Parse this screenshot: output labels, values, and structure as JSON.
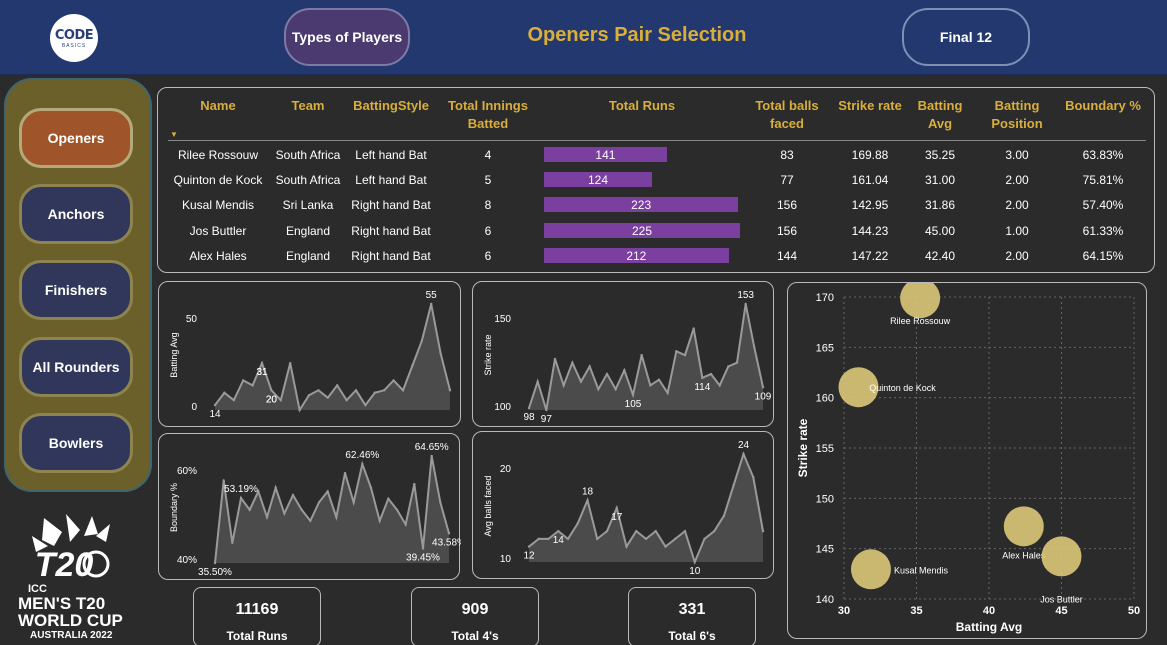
{
  "header": {
    "logo_line1": "CODE",
    "logo_line2": "BASICS",
    "types_button": "Types of Players",
    "title": "Openers Pair Selection",
    "final_button": "Final 12"
  },
  "sidebar": {
    "items": [
      {
        "label": "Openers",
        "active": true
      },
      {
        "label": "Anchors",
        "active": false
      },
      {
        "label": "Finishers",
        "active": false
      },
      {
        "label": "All Rounders",
        "active": false
      },
      {
        "label": "Bowlers",
        "active": false
      }
    ]
  },
  "branding": {
    "line1": "ICC",
    "line2": "MEN'S T20",
    "line3": "WORLD CUP",
    "line4": "AUSTRALIA 2022"
  },
  "table": {
    "headers": [
      "Name",
      "Team",
      "BattingStyle",
      "Total Innings Batted",
      "Total Runs",
      "Total balls faced",
      "Strike rate",
      "Batting Avg",
      "Batting Position",
      "Boundary %"
    ],
    "sort_indicator": "▼",
    "runs_max": 225,
    "bar_color": "#7b3fa0",
    "rows": [
      {
        "name": "Rilee Rossouw",
        "team": "South Africa",
        "style": "Left hand Bat",
        "innings": "4",
        "runs": "141",
        "runs_value": 141,
        "balls": "83",
        "sr": "169.88",
        "avg": "35.25",
        "pos": "3.00",
        "boundary": "63.83%"
      },
      {
        "name": "Quinton de Kock",
        "team": "South Africa",
        "style": "Left hand Bat",
        "innings": "5",
        "runs": "124",
        "runs_value": 124,
        "balls": "77",
        "sr": "161.04",
        "avg": "31.00",
        "pos": "2.00",
        "boundary": "75.81%"
      },
      {
        "name": "Kusal Mendis",
        "team": "Sri Lanka",
        "style": "Right hand Bat",
        "innings": "8",
        "runs": "223",
        "runs_value": 223,
        "balls": "156",
        "sr": "142.95",
        "avg": "31.86",
        "pos": "2.00",
        "boundary": "57.40%"
      },
      {
        "name": "Jos Buttler",
        "team": "England",
        "style": "Right hand Bat",
        "innings": "6",
        "runs": "225",
        "runs_value": 225,
        "balls": "156",
        "sr": "144.23",
        "avg": "45.00",
        "pos": "1.00",
        "boundary": "61.33%"
      },
      {
        "name": "Alex Hales",
        "team": "England",
        "style": "Right hand Bat",
        "innings": "6",
        "runs": "212",
        "runs_value": 212,
        "balls": "144",
        "sr": "147.22",
        "avg": "42.40",
        "pos": "2.00",
        "boundary": "64.15%"
      }
    ]
  },
  "kpis": [
    {
      "value": "11169",
      "label": "Total Runs"
    },
    {
      "value": "909",
      "label": "Total 4's"
    },
    {
      "value": "331",
      "label": "Total 6's"
    }
  ],
  "chart_data": [
    {
      "type": "area",
      "ylabel": "Batting Avg",
      "ticks": [
        "50",
        "0"
      ],
      "values": [
        14,
        19,
        16,
        24,
        22,
        31,
        20,
        16,
        31,
        12,
        18,
        20,
        17,
        22,
        16,
        20,
        14,
        19,
        20,
        24,
        20,
        30,
        40,
        55,
        35,
        20
      ],
      "labels": [
        "14",
        "31",
        "31",
        "55",
        "20",
        "20"
      ]
    },
    {
      "type": "area",
      "ylabel": "Strike rate",
      "ticks": [
        "150",
        "100"
      ],
      "values": [
        98,
        112,
        97,
        124,
        110,
        122,
        112,
        120,
        108,
        116,
        108,
        118,
        105,
        126,
        110,
        113,
        106,
        128,
        126,
        140,
        114,
        116,
        110,
        120,
        122,
        153,
        130,
        109
      ],
      "labels": [
        "98",
        "97",
        "105",
        "114",
        "153",
        "109"
      ]
    },
    {
      "type": "area",
      "ylabel": "Boundary %",
      "ticks": [
        "60%",
        "40%"
      ],
      "values": [
        35.5,
        58,
        41,
        53.19,
        50,
        55,
        48,
        56,
        49,
        54,
        50,
        47,
        52,
        55,
        48,
        60,
        52,
        62.46,
        56,
        47,
        53,
        50,
        46,
        57,
        39.45,
        64.65,
        52,
        43.58
      ],
      "labels": [
        "35.50%",
        "53.19%",
        "62.46%",
        "64.65%",
        "39.45%",
        "43.58%"
      ]
    },
    {
      "type": "area",
      "ylabel": "Avg balls faced",
      "ticks": [
        "20",
        "10"
      ],
      "values": [
        12,
        13,
        13,
        14,
        13,
        15,
        18,
        13,
        14,
        17,
        12,
        14,
        13,
        14,
        12,
        13,
        14,
        10,
        13,
        14,
        16,
        20,
        24,
        21,
        14
      ],
      "labels": [
        "12",
        "18",
        "17",
        "10",
        "24",
        "14"
      ]
    },
    {
      "type": "scatter",
      "xlabel": "Batting Avg",
      "ylabel": "Strike rate",
      "xlim": [
        30,
        50
      ],
      "ylim": [
        140,
        170
      ],
      "xticks": [
        "30",
        "35",
        "40",
        "45",
        "50"
      ],
      "yticks": [
        "140",
        "145",
        "150",
        "155",
        "160",
        "165",
        "170"
      ],
      "points": [
        {
          "name": "Rilee Rossouw",
          "x": 35.25,
          "y": 169.88
        },
        {
          "name": "Quinton de Kock",
          "x": 31.0,
          "y": 161.04
        },
        {
          "name": "Kusal Mendis",
          "x": 31.86,
          "y": 142.95
        },
        {
          "name": "Alex Hales",
          "x": 42.4,
          "y": 147.22
        },
        {
          "name": "Jos Buttler",
          "x": 45.0,
          "y": 144.23
        }
      ],
      "point_color": "#dcc878"
    }
  ]
}
